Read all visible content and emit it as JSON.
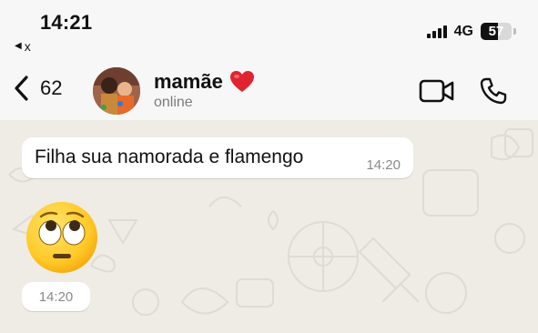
{
  "status_bar": {
    "time": "14:21",
    "back_app_label": "x",
    "network": "4G",
    "battery_level": 57,
    "battery_text": "57"
  },
  "header": {
    "unread_count": "62",
    "contact_name": "mamãe",
    "contact_name_emoji": "❤️",
    "contact_status": "online",
    "icons": {
      "back": "chevron-left-icon",
      "video": "video-camera-icon",
      "call": "phone-icon"
    }
  },
  "messages": [
    {
      "text": "Filha sua namorada e flamengo",
      "time": "14:20",
      "direction": "incoming"
    },
    {
      "emoji": "🙄",
      "emoji_name": "face-with-rolling-eyes",
      "time": "14:20",
      "direction": "incoming"
    }
  ],
  "colors": {
    "chat_background": "#efebe5",
    "header_background": "#f7f7f7",
    "bubble_incoming": "#ffffff",
    "heart": "#e0242f"
  }
}
